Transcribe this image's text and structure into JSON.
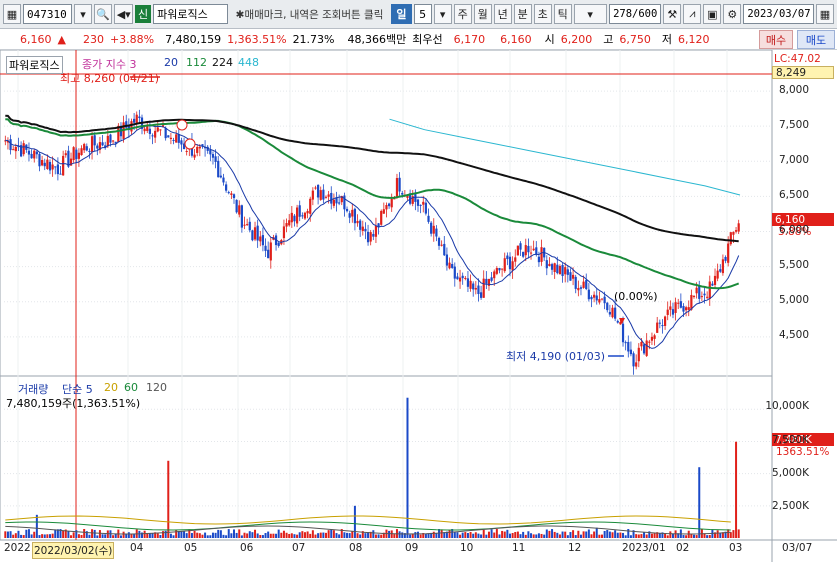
{
  "toolbar": {
    "code": "047310",
    "badge": "신",
    "name": "파워로직스",
    "hint": "✱매매마크, 내역은 조회버튼 클릭",
    "period_selected": "일",
    "period_number": "5",
    "periods": [
      "주",
      "월",
      "년",
      "분",
      "초",
      "틱"
    ],
    "count": "278/600",
    "date": "2023/03/07"
  },
  "quote": {
    "price": "6,160",
    "change": "230",
    "change_pct": "+3.88%",
    "volume": "7,480,159",
    "volume_pct": "1,363.51%",
    "turnover": "21.73%",
    "amount": "48,366백만",
    "best_label": "최우선",
    "best_ask": "6,170",
    "best_bid": "6,160",
    "open_label": "시",
    "open": "6,200",
    "high_label": "고",
    "high": "6,750",
    "low_label": "저",
    "low": "6,120",
    "sell_label": "매수",
    "buy_label": "매도"
  },
  "price_panel": {
    "legend_name": "파워로직스",
    "legend_ma": "종가 지수 3",
    "ma_periods": [
      "20",
      "112",
      "224",
      "448"
    ],
    "ma_colors": [
      "#1a3aa8",
      "#1a8a3a",
      "#111111",
      "#2bb7d0"
    ],
    "high_annotation": "최고 8,260 (04/21)",
    "low_annotation": "최저 4,190 (01/03)",
    "mid_annotation": "(0.00%)",
    "top_flag": "8,249",
    "top_label": "LC:47.02",
    "price_flag": "6,160",
    "price_flag_pct": "3.88%",
    "y_ticks": [
      "8,000",
      "7,500",
      "7,000",
      "6,500",
      "6,000",
      "5,500",
      "5,000",
      "4,500"
    ]
  },
  "volume_panel": {
    "legend_name": "거래량",
    "legend_ma": "단순 5",
    "ma_periods": [
      "20",
      "60",
      "120"
    ],
    "ma_colors": [
      "#1a3aa8",
      "#c8a000",
      "#1a8a3a",
      "#555555"
    ],
    "current": "7,480,159주(1,363.51%)",
    "flag": "7,480K",
    "flag_pct": "1363.51%",
    "y_ticks": [
      "10,000K",
      "7,500K",
      "5,000K",
      "2,500K"
    ]
  },
  "x_axis": {
    "labels": [
      "2022",
      "2022/03/02(수)",
      "04",
      "05",
      "06",
      "07",
      "08",
      "09",
      "10",
      "11",
      "12",
      "2023/01",
      "02",
      "03",
      "03/07"
    ]
  },
  "chart_data": {
    "type": "candlestick",
    "price_range": [
      4000,
      8300
    ],
    "volume_range": [
      0,
      11500
    ],
    "months": [
      "2022-02",
      "2022-03",
      "2022-04",
      "2022-05",
      "2022-06",
      "2022-07",
      "2022-08",
      "2022-09",
      "2022-10",
      "2022-11",
      "2022-12",
      "2023-01",
      "2023-02",
      "2023-03"
    ],
    "close_path": [
      7300,
      7100,
      6900,
      7200,
      7300,
      7600,
      7400,
      7200,
      7000,
      6200,
      5700,
      6200,
      6600,
      6400,
      5900,
      6700,
      6300,
      5400,
      5100,
      5500,
      5800,
      5500,
      5200,
      5000,
      4190,
      4700,
      5000,
      5200,
      6160
    ],
    "ma448": [
      null,
      null,
      null,
      null,
      null,
      null,
      null,
      null,
      null,
      null,
      null,
      7600,
      7450,
      7350,
      7250,
      7150,
      7050,
      6950,
      6850,
      6750,
      6650,
      6520
    ],
    "volume_spikes_k": [
      1800,
      700,
      600,
      6000,
      400,
      500,
      2500,
      10900,
      700,
      500,
      400,
      800,
      300,
      5500,
      7480
    ]
  }
}
